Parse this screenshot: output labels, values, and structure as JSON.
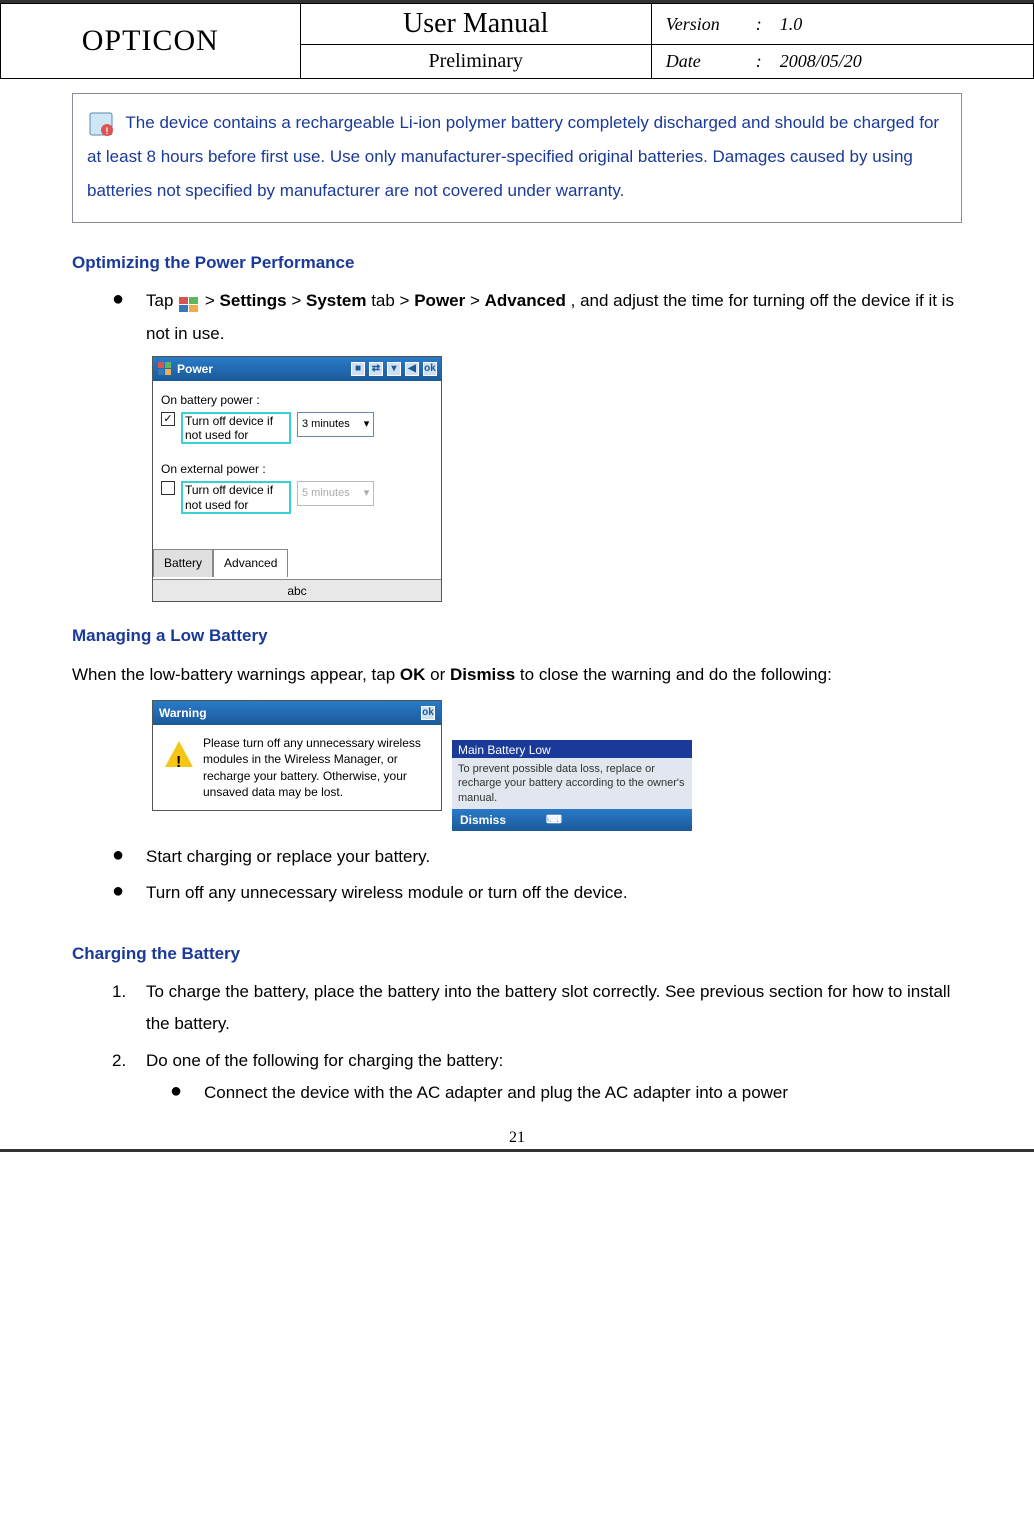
{
  "header": {
    "brand": "OPTICON",
    "title": "User Manual",
    "subtitle": "Preliminary",
    "version_label": "Version",
    "version_value": "1.0",
    "date_label": "Date",
    "date_value": "2008/05/20"
  },
  "note": {
    "text": "The device contains a rechargeable Li-ion polymer battery completely discharged and should be charged for at least 8 hours before first use. Use only manufacturer-specified original batteries. Damages caused by using batteries not specified by manufacturer are not covered under warranty."
  },
  "opt": {
    "heading": "Optimizing the Power Performance",
    "line1a": "Tap ",
    "line1b": " > ",
    "settings": "Settings",
    "gt1": " > ",
    "system": "System",
    "tab_word": " tab > ",
    "power": "Power",
    "gt2": " > ",
    "advanced": "Advanced",
    "line1c": ", and adjust the time for turning off the device if it is not in use."
  },
  "power_ss": {
    "title": "Power",
    "ok": "ok",
    "batt_label": "On battery power :",
    "turnoff1": "Turn off device if not used for",
    "sel1": "3 minutes",
    "ext_label": "On external power :",
    "turnoff2": "Turn off device if not used for",
    "sel2": "5 minutes",
    "tab1": "Battery",
    "tab2": "Advanced",
    "kb": "abc"
  },
  "low": {
    "heading": "Managing a Low Battery",
    "intro_a": "When the low-battery warnings appear, tap ",
    "ok": "OK",
    "intro_b": " or ",
    "dismiss": "Dismiss",
    "intro_c": " to close the warning and do the following:"
  },
  "warn_ss": {
    "title": "Warning",
    "ok": "ok",
    "body": "Please turn off any unnecessary wireless modules in the Wireless Manager, or recharge your battery. Otherwise, your unsaved data may be lost."
  },
  "batt_ss": {
    "title": "Main Battery Low",
    "body": "To prevent possible data loss, replace or recharge your battery according to the owner's manual.",
    "dismiss": "Dismiss"
  },
  "low_bullets": {
    "b1": "Start charging or replace your battery.",
    "b2": "Turn off any unnecessary wireless module or turn off the device."
  },
  "charge": {
    "heading": "Charging the Battery",
    "i1": "To charge the battery, place the battery into the battery slot correctly. See previous section for how to install the battery.",
    "i2": "Do one of the following for charging the battery:",
    "sub1": "Connect the device with the AC adapter and plug the AC adapter into a power"
  },
  "page_number": "21"
}
